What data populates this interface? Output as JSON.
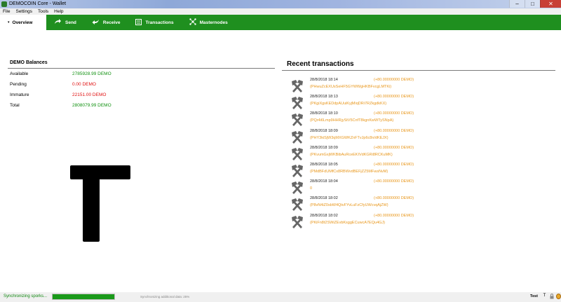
{
  "window": {
    "title": "DEMOCOIN Core - Wallet",
    "minimize": "–",
    "maximize": "□",
    "close": "✕"
  },
  "menu": [
    "File",
    "Settings",
    "Tools",
    "Help"
  ],
  "tabs": [
    {
      "label": "Overview",
      "icon": "home-icon",
      "active": true
    },
    {
      "label": "Send",
      "icon": "send-arrow-icon"
    },
    {
      "label": "Receive",
      "icon": "receive-arrow-icon"
    },
    {
      "label": "Transactions",
      "icon": "transactions-icon"
    },
    {
      "label": "Masternodes",
      "icon": "masternodes-icon"
    }
  ],
  "balances": {
    "heading": "DEMO Balances",
    "rows": [
      {
        "label": "Available",
        "value": "2785928.99 DEMO",
        "color": "#119111"
      },
      {
        "label": "Pending",
        "value": "0.00 DEMO",
        "color": "#e01010"
      },
      {
        "label": "Immature",
        "value": "22151.00 DEMO",
        "color": "#e01010"
      },
      {
        "label": "Total",
        "value": "2808079.99 DEMO",
        "color": "#119111"
      }
    ]
  },
  "recent": {
    "heading": "Recent transactions",
    "items": [
      {
        "date": "28/8/2018 18:14",
        "amount": "(+80.00000000 DEMO)",
        "address": "(PHwuZcEXUsSeHF5GYWWgHKBFvcgLMTKi)"
      },
      {
        "date": "28/8/2018 18:13",
        "amount": "(+80.00000000 DEMO)",
        "address": "(PKgiXgsKEDdpAUuiKyjMiqDRi7RZkgdkKX)"
      },
      {
        "date": "28/8/2018 18:10",
        "amount": "(+80.00000000 DEMO)",
        "address": "(PQr4i6Lmp9HHRjyStV5CnfT8kgnKwWTySNpA)"
      },
      {
        "date": "28/8/2018 18:09",
        "amount": "(+80.00000000 DEMO)",
        "address": "(PHY3kiSjW3qMXGWKZnFTvJp6c8n/dKEJX)"
      },
      {
        "date": "28/8/2018 18:09",
        "amount": "(+80.00000000 DEMO)",
        "address": "(PKvumGxjWKBibAuRceEKIVdKGRi8RCKuMK)"
      },
      {
        "date": "28/8/2018 18:05",
        "amount": "(+80.00000000 DEMO)",
        "address": "(PMdBFdUMfCx8RBWvdBEFjZZ5MFwsNvM)"
      },
      {
        "date": "28/8/2018 18:04",
        "amount": "(+80.00000000 DEMO)",
        "address": "0"
      },
      {
        "date": "28/8/2018 18:02",
        "amount": "(+80.00000000 DEMO)",
        "address": "(P8vN4iZ0sbW4QtvFYvLuFzCfyUWcvqAjZW)"
      },
      {
        "date": "28/8/2018 18:02",
        "amount": "(+80.00000000 DEMO)",
        "address": "(PKiFn8t2SWiZEvbKsggECuwcA7EQu4GJ)"
      }
    ]
  },
  "status": {
    "sync_label": "Synchronizing sporks...",
    "progress_fraction": 1.0,
    "sync_detail": "Synchronizing additional data: 25%",
    "network": "Test",
    "icons": [
      "T",
      "lock-icon",
      "coin-icon"
    ]
  },
  "colors": {
    "toolbar": "#1f8f1f",
    "positive": "#119111",
    "negative": "#e01010",
    "tx_amount": "#e8961a"
  }
}
